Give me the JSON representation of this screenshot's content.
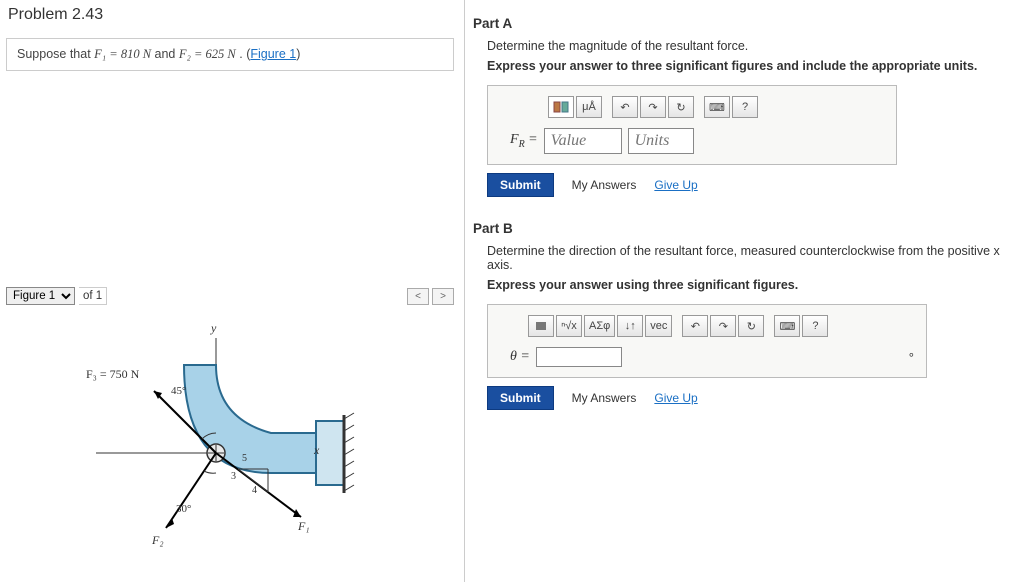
{
  "problem": {
    "title": "Problem 2.43",
    "suppose_prefix": "Suppose that ",
    "f1_eq": "F₁ = 810  N",
    "and": " and ",
    "f2_eq": "F₂ = 625  N",
    "period_link_prefix": " . (",
    "figure1_link": "Figure 1",
    "link_suffix": ")"
  },
  "figure_selector": {
    "select_label": "Figure 1",
    "of": "of 1"
  },
  "figure": {
    "y_label": "y",
    "x_label": "x",
    "f3_label": "F₃ = 750 N",
    "angle45": "45°",
    "angle30": "30°",
    "slope5": "5",
    "slope3": "3",
    "slope4": "4",
    "f1_label": "F₁",
    "f2_label": "F₂"
  },
  "partA": {
    "label": "Part A",
    "text": "Determine the magnitude of the resultant force.",
    "instr": "Express your answer to three significant figures and include the appropriate units.",
    "fr_label_html": "F",
    "fr_sub": "R",
    "equals": " =",
    "value_ph": "Value",
    "units_ph": "Units",
    "toolbar": {
      "ua": "μÅ",
      "undo": "↶",
      "redo": "↷",
      "refresh": "↻",
      "kbd": "⌨",
      "help": "?"
    }
  },
  "partB": {
    "label": "Part B",
    "text": "Determine the direction of the resultant force, measured counterclockwise from the positive x axis.",
    "instr": "Express your answer using three significant figures.",
    "theta": "θ =",
    "deg": "°",
    "toolbar": {
      "sqrt": "ⁿ√x",
      "greek": "ΑΣφ",
      "updown": "↓↑",
      "vec": "vec",
      "undo": "↶",
      "redo": "↷",
      "refresh": "↻",
      "kbd": "⌨",
      "help": "?"
    }
  },
  "common": {
    "submit": "Submit",
    "my_answers": "My Answers",
    "give_up": "Give Up"
  }
}
